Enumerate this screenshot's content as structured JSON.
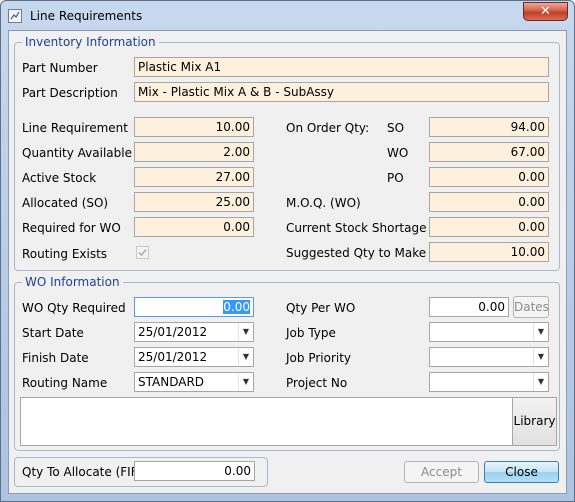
{
  "window": {
    "title": "Line Requirements",
    "close_symbol": "✕"
  },
  "inventory": {
    "legend": "Inventory Information",
    "part_number_label": "Part Number",
    "part_number": "Plastic Mix A1",
    "part_description_label": "Part Description",
    "part_description": "Mix - Plastic Mix A & B - SubAssy",
    "line_requirement_label": "Line Requirement",
    "line_requirement": "10.00",
    "quantity_available_label": "Quantity Available",
    "quantity_available": "2.00",
    "active_stock_label": "Active Stock",
    "active_stock": "27.00",
    "allocated_so_label": "Allocated (SO)",
    "allocated_so": "25.00",
    "required_for_wo_label": "Required for WO",
    "required_for_wo": "0.00",
    "routing_exists_label": "Routing Exists",
    "routing_exists_checked": true,
    "on_order_label": "On Order Qty:",
    "so_label": "SO",
    "so_value": "94.00",
    "wo_label": "WO",
    "wo_value": "67.00",
    "po_label": "PO",
    "po_value": "0.00",
    "moq_label": "M.O.Q. (WO)",
    "moq_value": "0.00",
    "shortage_label": "Current Stock Shortage",
    "shortage_value": "0.00",
    "suggested_label": "Suggested Qty to Make",
    "suggested_value": "10.00"
  },
  "wo": {
    "legend": "WO Information",
    "qty_required_label": "WO Qty Required",
    "qty_required": "0.00",
    "start_date_label": "Start Date",
    "start_date": "25/01/2012",
    "finish_date_label": "Finish Date",
    "finish_date": "25/01/2012",
    "routing_name_label": "Routing Name",
    "routing_name": "STANDARD",
    "qty_per_wo_label": "Qty Per WO",
    "qty_per_wo": "0.00",
    "dates_button": "Dates",
    "job_type_label": "Job Type",
    "job_type": "",
    "job_priority_label": "Job Priority",
    "job_priority": "",
    "project_no_label": "Project No",
    "project_no": "",
    "notes": "",
    "library_button": "Library"
  },
  "allocate": {
    "label": "Qty To Allocate (FIFO)",
    "value": "0.00"
  },
  "buttons": {
    "accept": "Accept",
    "close": "Close"
  },
  "colors": {
    "readonly_field": "#fdf0dc",
    "legend_text": "#1f3f9a",
    "selection": "#3399ff"
  }
}
